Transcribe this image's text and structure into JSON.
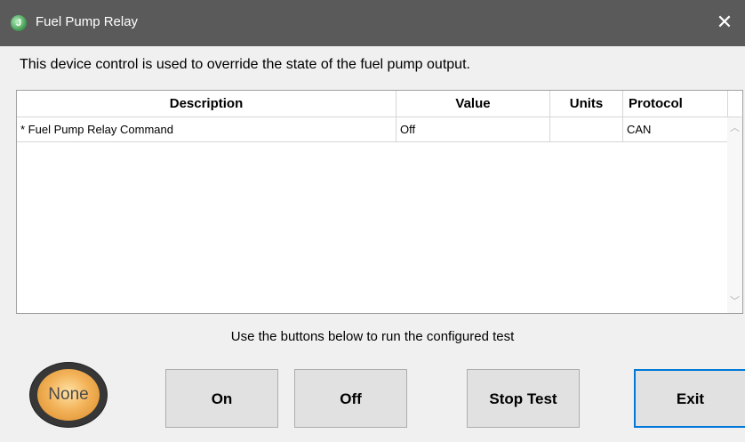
{
  "window": {
    "title": "Fuel Pump Relay",
    "close_glyph": "✕",
    "app_icon_glyph": "J"
  },
  "description": "This device control is used to override the state of the fuel pump output.",
  "table": {
    "columns": [
      "Description",
      "Value",
      "Units",
      "Protocol"
    ],
    "rows": [
      {
        "description": "* Fuel Pump Relay Command",
        "value": "Off",
        "units": "",
        "protocol": "CAN"
      }
    ]
  },
  "instruction": "Use the buttons below to run the configured test",
  "status_indicator": {
    "label": "None",
    "color": "#f3b35a"
  },
  "buttons": {
    "on": "On",
    "off": "Off",
    "stop_test": "Stop Test",
    "exit": "Exit"
  },
  "colors": {
    "titlebar": "#5a5a5a",
    "focus_border": "#0078d7"
  }
}
